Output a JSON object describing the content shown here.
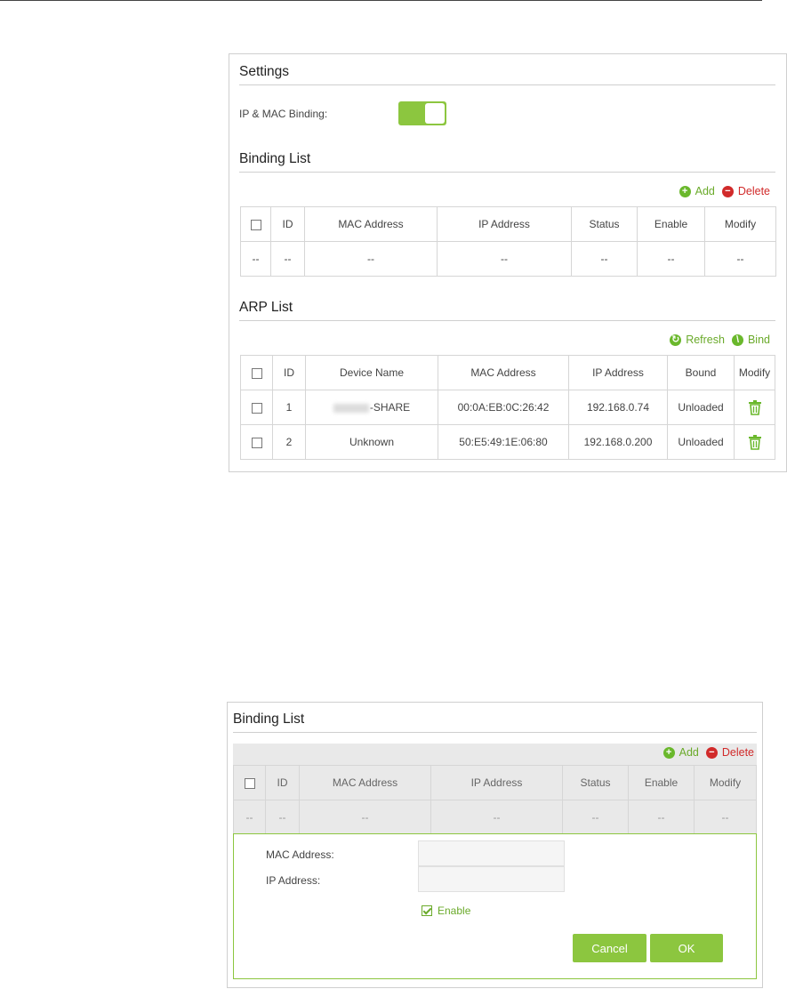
{
  "panel1": {
    "settings_title": "Settings",
    "ip_mac_binding_label": "IP & MAC Binding:",
    "ip_mac_binding_on": true,
    "binding_list_title": "Binding List",
    "add_label": "Add",
    "delete_label": "Delete",
    "binding_headers": [
      "ID",
      "MAC Address",
      "IP Address",
      "Status",
      "Enable",
      "Modify"
    ],
    "binding_empty_row": [
      "--",
      "--",
      "--",
      "--",
      "--",
      "--",
      "--"
    ],
    "arp_list_title": "ARP List",
    "refresh_label": "Refresh",
    "bind_label": "Bind",
    "arp_headers": [
      "ID",
      "Device Name",
      "MAC Address",
      "IP Address",
      "Bound",
      "Modify"
    ],
    "arp_rows": [
      {
        "id": "1",
        "device": "-SHARE",
        "mac": "00:0A:EB:0C:26:42",
        "ip": "192.168.0.74",
        "bound": "Unloaded"
      },
      {
        "id": "2",
        "device": "Unknown",
        "mac": "50:E5:49:1E:06:80",
        "ip": "192.168.0.200",
        "bound": "Unloaded"
      }
    ]
  },
  "panel2": {
    "binding_list_title": "Binding List",
    "add_label": "Add",
    "delete_label": "Delete",
    "binding_headers": [
      "ID",
      "MAC Address",
      "IP Address",
      "Status",
      "Enable",
      "Modify"
    ],
    "binding_empty_row": [
      "--",
      "--",
      "--",
      "--",
      "--",
      "--",
      "--"
    ],
    "mac_label": "MAC Address:",
    "ip_label": "IP Address:",
    "mac_value": "",
    "ip_value": "",
    "enable_label": "Enable",
    "enable_checked": true,
    "cancel_label": "Cancel",
    "ok_label": "OK"
  },
  "colors": {
    "accent_green": "#8cc63f",
    "link_green": "#6aaa2a",
    "delete_red": "#d12a2a"
  }
}
